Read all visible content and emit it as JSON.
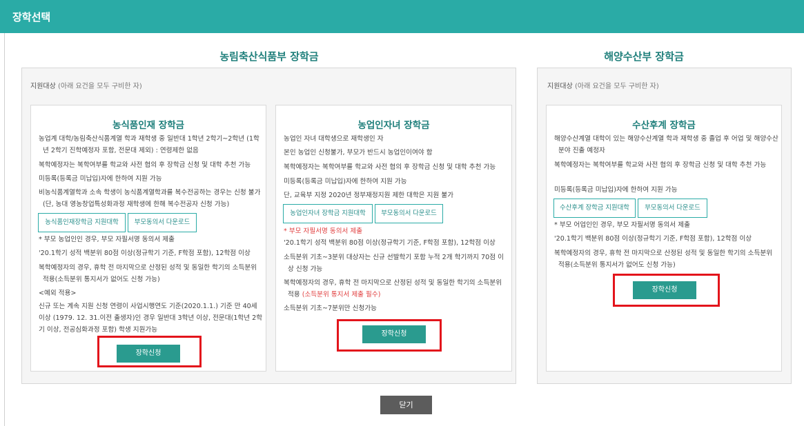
{
  "titlebar": {
    "title": "장학선택"
  },
  "sections": {
    "agri": {
      "title": "농림축산식품부 장학금",
      "target_label": "지원대상",
      "target_paren": "(아래 요건을 모두 구비한 자)"
    },
    "ocean": {
      "title": "해양수산부 장학금",
      "target_label": "지원대상",
      "target_paren": "(아래 요건을 모두 구비한 자)"
    }
  },
  "cards": {
    "talent": {
      "title": "농식품인재 장학금",
      "items": [
        "농업계 대학/농림축산식품계열 학과 재학생 중 일반대 1학년 2학기~2학년 (1학년 2학기 진학예정자 포함, 전문대 제외) : 연령제한 없음",
        "복학예정자는 복학여부를 학교와 사전 협의 후 장학금 신청 및 대학 추천 가능",
        "미등록(등록금 미납입)자에 한하여 지원 가능",
        "비농식품계열학과 소속 학생이 농식품계열학과를 복수전공하는 경우는 신청 불가(단, 농대 영농창업특성화과정 재학생에 한해 복수전공자 신청 가능)"
      ],
      "btn_univ": "농식품인재장학금 지원대학",
      "btn_consent": "부모동의서 다운로드",
      "notes": [
        "* 부모 농업인인 경우, 부모 자필서명 동의서 제출",
        "'20.1학기 성적 백분위 80점 이상(정규학기 기준, F학점 포함), 12학점 이상",
        "복학예정자의 경우, 휴학 전 마지막으로 산정된 성적 및 동일한 학기의 소득분위 적용(소득분위 통지서가 없어도 신청 가능)",
        "<예외 적용>",
        "신규 또는 계속 지원 신청 연령이 사업시행연도 기준(2020.1.1.) 기준 만 40세 이상 (1979. 12. 31.이전 출생자)인 경우 일반대 3학년 이상, 전문대(1학년 2학기 이상, 전공심화과정 포함) 학생 지원가능"
      ],
      "apply": "장학신청"
    },
    "successor": {
      "title": "농업인자녀 장학금",
      "items": [
        "농업인 자녀 대학생으로 재학생인 자",
        "본인 농업인 신청불가, 부모가 반드시 농업인이여야 함",
        "복학예정자는 복학여부를 학교와 사전 협의 후 장학금 신청 및 대학 추천 가능",
        "미등록(등록금 미납입)자에 한하여 지원 가능",
        "단, 교육부 지정 2020년 정부재정지원 제한 대학은 지원 불가"
      ],
      "btn_univ": "농업인자녀 장학금 지원대학",
      "btn_consent": "부모동의서 다운로드",
      "red_note": "* 부모 자필서명 동의서 제출",
      "notes": [
        "'20.1학기 성적 백분위 80점 이상(정규학기 기준, F학점 포함), 12학점 이상",
        "소득분위 기초~3분위 대상자는 신규 선발학기 포함 누적 2개 학기까지 70점 이상 신청 가능"
      ],
      "resume_text": "복학예정자의 경우, 휴학 전 마지막으로 산정된 성적 및 동일한 학기의 소득분위 적용",
      "resume_red": "(소득분위 통지서 제출 필수)",
      "last_note": "소득분위 기초~7분위만 신청가능",
      "apply": "장학신청"
    },
    "fishery": {
      "title": "수산후계 장학금",
      "items": [
        "해양수산계열 대학이 있는 해양수산계열 학과 재학생 중 졸업 후 어업 및 해양수산분야 진출 예정자",
        "복학예정자는 복학여부를 학교와 사전 협의 후 장학금 신청 및 대학 추천 가능",
        "미등록(등록금 미납입)자에 한하여 지원 가능"
      ],
      "btn_univ": "수산후계 장학금 지원대학",
      "btn_consent": "부모동의서 다운로드",
      "notes": [
        "* 부모 어업인인 경우, 부모 자필서명 동의서 제출",
        "'20.1학기 백분위 80점 이상(정규학기 기준, F학점 포함), 12학점 이상",
        "복학예정자의 경우, 휴학 전 마지막으로 산정된 성적 및 동일한 학기의 소득분위 적용(소득분위 통지서가 없어도 신청 가능)"
      ],
      "apply": "장학신청"
    }
  },
  "footer": {
    "close": "닫기"
  }
}
